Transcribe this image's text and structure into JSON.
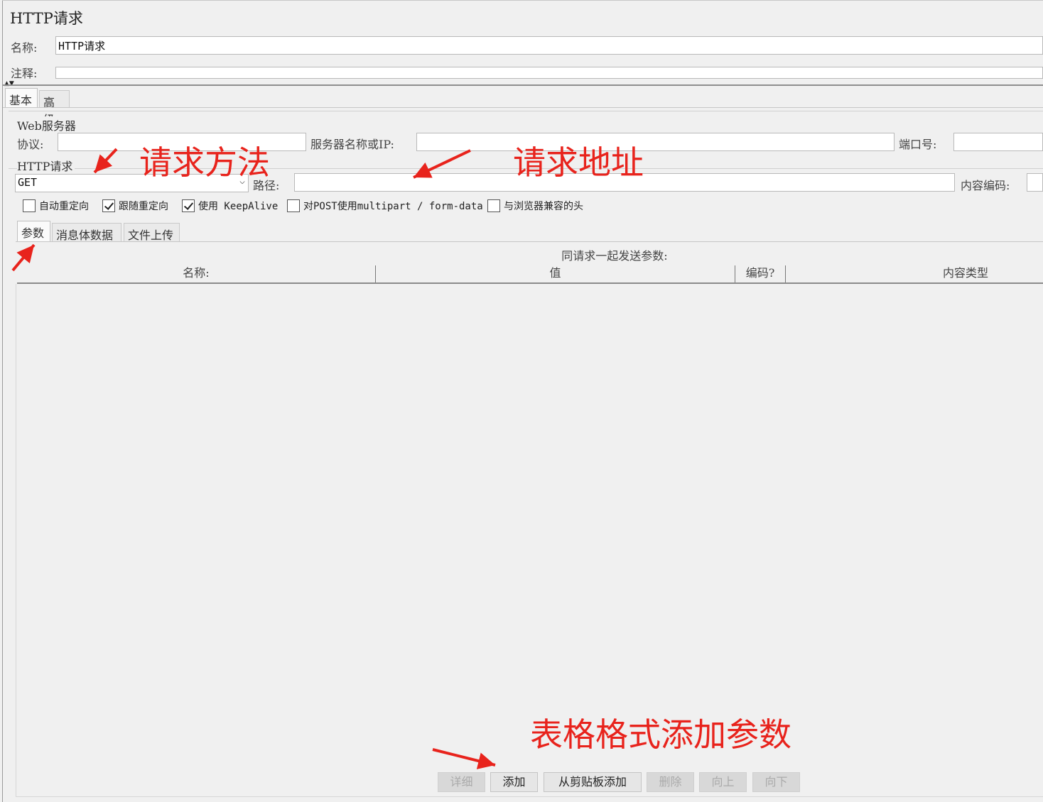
{
  "window": {
    "title": "HTTP请求"
  },
  "form": {
    "name_label": "名称:",
    "name_value": "HTTP请求",
    "comment_label": "注释:",
    "comment_value": ""
  },
  "outer_tabs": [
    {
      "label": "基本"
    },
    {
      "label": "高级"
    }
  ],
  "web_server": {
    "section_title": "Web服务器",
    "protocol_label": "协议:",
    "protocol_value": "",
    "server_label": "服务器名称或IP:",
    "server_value": "",
    "port_label": "端口号:",
    "port_value": ""
  },
  "http_request": {
    "section_title": "HTTP请求",
    "method_value": "GET",
    "path_label": "路径:",
    "path_value": "",
    "encoding_label": "内容编码:",
    "encoding_value": ""
  },
  "checkboxes": [
    {
      "label": "自动重定向",
      "checked": false
    },
    {
      "label": "跟随重定向",
      "checked": true
    },
    {
      "label": "使用 KeepAlive",
      "checked": true
    },
    {
      "label": "对POST使用multipart / form-data",
      "checked": false
    },
    {
      "label": "与浏览器兼容的头",
      "checked": false
    }
  ],
  "inner_tabs": [
    {
      "label": "参数"
    },
    {
      "label": "消息体数据"
    },
    {
      "label": "文件上传"
    }
  ],
  "params_table": {
    "caption": "同请求一起发送参数:",
    "columns": [
      "名称:",
      "值",
      "编码?",
      "内容类型"
    ]
  },
  "buttons": {
    "detail": "详细",
    "add": "添加",
    "add_from_clipboard": "从剪贴板添加",
    "delete": "删除",
    "up": "向上",
    "down": "向下"
  },
  "annotations": {
    "method": "请求方法",
    "address": "请求地址",
    "table_add": "表格格式添加参数",
    "color": "#e8231c"
  }
}
